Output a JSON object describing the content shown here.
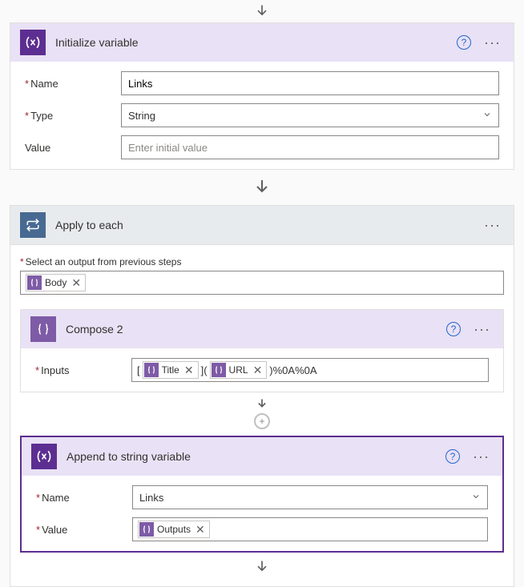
{
  "init_var": {
    "title": "Initialize variable",
    "name_label": "Name",
    "name_value": "Links",
    "type_label": "Type",
    "type_value": "String",
    "value_label": "Value",
    "value_placeholder": "Enter initial value"
  },
  "apply_each": {
    "title": "Apply to each",
    "select_label": "Select an output from previous steps",
    "body_token": "Body"
  },
  "compose2": {
    "title": "Compose 2",
    "inputs_label": "Inputs",
    "literal_open": "[",
    "token_title": "Title",
    "literal_mid": "](",
    "token_url": "URL",
    "literal_end": ")%0A%0A"
  },
  "append": {
    "title": "Append to string variable",
    "name_label": "Name",
    "name_value": "Links",
    "value_label": "Value",
    "outputs_token": "Outputs"
  }
}
